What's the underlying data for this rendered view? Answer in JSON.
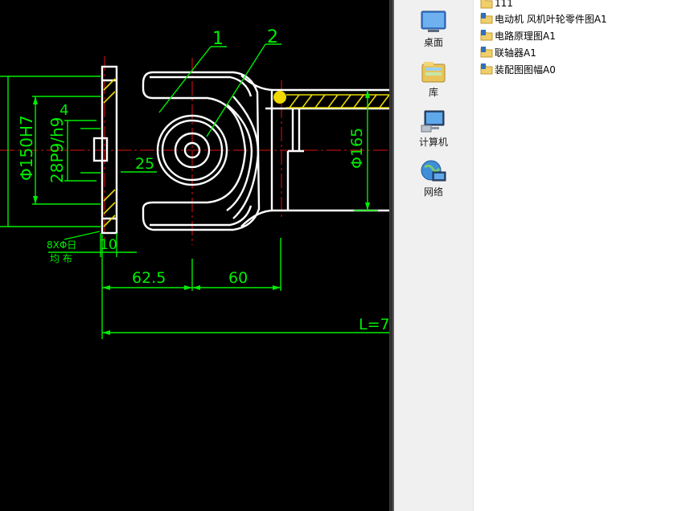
{
  "drawing": {
    "leaders": [
      "1",
      "2"
    ],
    "dims": {
      "bore": "Φ150H7",
      "key": "28P9/h9",
      "four": "4",
      "twentyfive": "25",
      "ten": "10",
      "bolts": "8XΦ日",
      "even": "均 布",
      "d62": "62.5",
      "d60": "60",
      "shaft": "Φ165",
      "length": "L=7"
    },
    "colors": {
      "bg": "#000000",
      "dim": "#00ff00",
      "outline": "#ffffff",
      "center": "#ff0000",
      "hatch": "#ffff00"
    }
  },
  "nav": {
    "items": [
      {
        "label": "桌面",
        "icon": "desktop-icon"
      },
      {
        "label": "库",
        "icon": "library-icon"
      },
      {
        "label": "计算机",
        "icon": "computer-icon"
      },
      {
        "label": "网络",
        "icon": "network-icon"
      }
    ]
  },
  "files": {
    "items": [
      {
        "name": "111",
        "icon": "folder-icon"
      },
      {
        "name": "电动机 风机叶轮零件图A1",
        "icon": "shared-folder-icon"
      },
      {
        "name": "电路原理图A1",
        "icon": "shared-folder-icon"
      },
      {
        "name": "联轴器A1",
        "icon": "shared-folder-icon"
      },
      {
        "name": "装配图图幅A0",
        "icon": "shared-folder-icon"
      }
    ]
  }
}
